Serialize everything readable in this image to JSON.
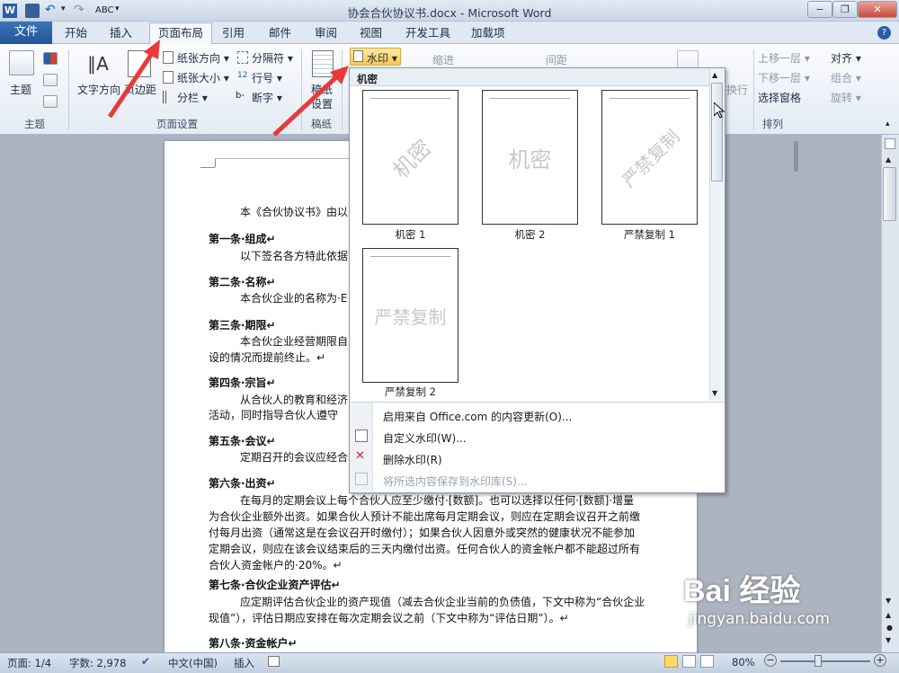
{
  "window": {
    "title": "协会合伙协议书.docx - Microsoft Word",
    "minimize": "−",
    "restore": "❐",
    "close": "✕"
  },
  "qat": {
    "dropdown": "▾"
  },
  "tabs": [
    "文件",
    "开始",
    "插入",
    "页面布局",
    "引用",
    "邮件",
    "审阅",
    "视图",
    "开发工具",
    "加载项"
  ],
  "ribbon": {
    "theme": {
      "label": "主题",
      "group": "主题"
    },
    "page_setup": {
      "group": "页面设置",
      "text_direction": "文字方向",
      "margins": "页边距",
      "orientation": "纸张方向 ▾",
      "size": "纸张大小 ▾",
      "columns": "分栏 ▾",
      "breaks": "分隔符 ▾",
      "line_numbers": "行号 ▾",
      "hyphenation": "断字 ▾"
    },
    "draft": {
      "label1": "稿纸",
      "label2": "设置",
      "group": "稿纸"
    },
    "watermark_button": "水印 ▾",
    "indent": "缩进",
    "spacing": "间距",
    "wrap": "换行",
    "arrange": {
      "group": "排列",
      "bring_forward": "上移一层 ▾",
      "send_backward": "下移一层 ▾",
      "selection_pane": "选择窗格",
      "align": "对齐 ▾",
      "group_btn": "组合 ▾",
      "rotate": "旋转 ▾"
    }
  },
  "gallery": {
    "section": "机密",
    "items": [
      {
        "caption": "机密 1",
        "watermark": "机密"
      },
      {
        "caption": "机密 2",
        "watermark": "机密"
      },
      {
        "caption": "严禁复制 1",
        "watermark": "严禁复制"
      },
      {
        "caption": "严禁复制 2",
        "watermark": "严禁复制"
      }
    ],
    "menu": [
      {
        "label": "启用来自 Office.com 的内容更新(O)...",
        "enabled": true
      },
      {
        "label": "自定义水印(W)...",
        "enabled": true
      },
      {
        "label": "删除水印(R)",
        "enabled": true
      },
      {
        "label": "将所选内容保存到水印库(S)...",
        "enabled": false
      }
    ]
  },
  "document": {
    "lines": [
      "本《合伙协议书》由以",
      "第一条·组成↵",
      "以下签名各方特此依据",
      "第二条·名称↵",
      "本合伙企业的名称为·E",
      "第三条·期限↵",
      "本合伙企业经营期限自",
      "设的情况而提前终止。↵",
      "第四条·宗旨↵",
      "从合伙人的教育和经济",
      "活动，同时指导合伙人遵守",
      "第五条·会议↵",
      "定期召开的会议应经合",
      "第六条·出资↵",
      "在每月的定期会议上每个合伙人应至少缴付·[数额]。也可以选择以任何·[数额]·增量",
      "为合伙企业额外出资。如果合伙人预计不能出席每月定期会议，则应在定期会议召开之前缴",
      "付每月出资（通常这是在会议召开时缴付）；如果合伙人因意外或突然的健康状况不能参加",
      "定期会议，则应在该会议结束后的三天内缴付出资。任何合伙人的资金帐户都不能超过所有",
      "合伙人资金帐户的·20%。↵",
      "第七条·合伙企业资产评估↵",
      "应定期评估合伙企业的资产现值（减去合伙企业当前的负债值，下文中称为“合伙企业",
      "现值”），评估日期应安排在每次定期会议之前（下文中称为“评估日期”）。↵",
      "第八条·资金帐户↵"
    ]
  },
  "status": {
    "page": "页面: 1/4",
    "words": "字数: 2,978",
    "language": "中文(中国)",
    "insert": "插入",
    "zoom": "80%"
  },
  "watermark_brand": {
    "logo": "Bai 经验",
    "url": "jingyan.baidu.com"
  },
  "colors": {
    "accent": "#e83a3a",
    "file_tab": "#2a5ea6",
    "watermark_btn": "#fbd96b"
  }
}
